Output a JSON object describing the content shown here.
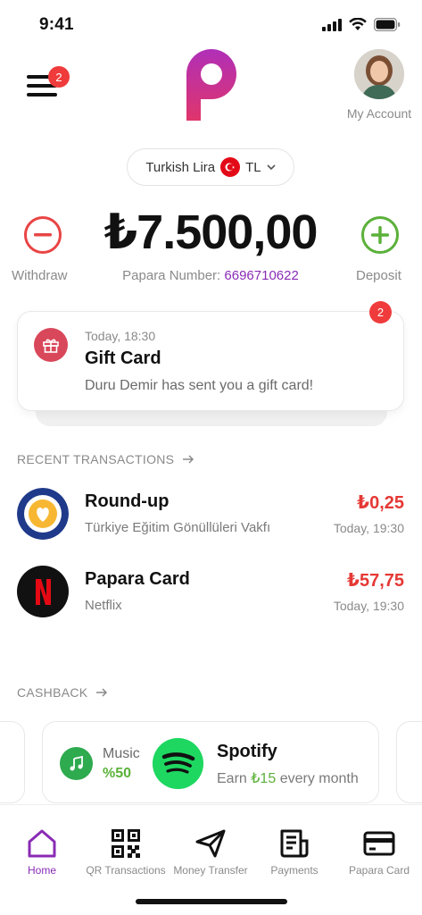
{
  "status_bar": {
    "time": "9:41"
  },
  "header": {
    "menu_badge": "2",
    "account_label": "My Account"
  },
  "currency": {
    "name": "Turkish Lira",
    "code": "TL"
  },
  "balance": {
    "amount": "₺7.500,00",
    "papara_number_label": "Papara Number:",
    "papara_number": "6696710622",
    "withdraw_label": "Withdraw",
    "deposit_label": "Deposit"
  },
  "notification": {
    "badge": "2",
    "time": "Today, 18:30",
    "title": "Gift Card",
    "message": "Duru Demir has sent you a gift card!"
  },
  "recent_transactions": {
    "title": "RECENT TRANSACTIONS",
    "items": [
      {
        "title": "Round-up",
        "subtitle": "Türkiye Eğitim Gönüllüleri Vakfı",
        "amount": "₺0,25",
        "time": "Today, 19:30",
        "icon": "tegv-logo-icon"
      },
      {
        "title": "Papara Card",
        "subtitle": "Netflix",
        "amount": "₺57,75",
        "time": "Today, 19:30",
        "icon": "netflix-icon"
      }
    ]
  },
  "cashback": {
    "title": "CASHBACK",
    "category": "Music",
    "percent": "%50",
    "merchant": "Spotify",
    "offer_prefix": "Earn",
    "offer_amount": "₺15",
    "offer_suffix": "every month"
  },
  "tabs": [
    {
      "label": "Home",
      "icon": "home-icon",
      "active": true
    },
    {
      "label": "QR Transactions",
      "icon": "qr-code-icon",
      "active": false
    },
    {
      "label": "Money Transfer",
      "icon": "send-icon",
      "active": false
    },
    {
      "label": "Payments",
      "icon": "receipt-icon",
      "active": false
    },
    {
      "label": "Papara Card",
      "icon": "card-icon",
      "active": false
    }
  ],
  "colors": {
    "brand": "#8a2bb5",
    "negative": "#e53935",
    "positive": "#5bb13a",
    "badge": "#ef3b3b"
  }
}
